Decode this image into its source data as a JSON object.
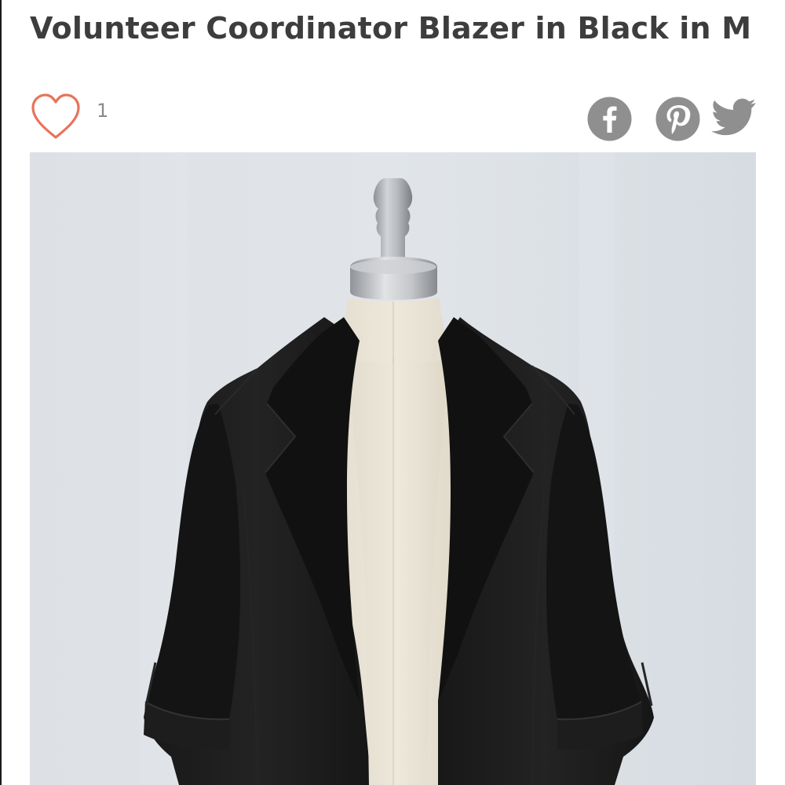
{
  "product": {
    "title": "Volunteer Coordinator Blazer in Black in M"
  },
  "likes": {
    "count": "1",
    "icon": "heart-outline-icon",
    "color": "#e8735a"
  },
  "share": {
    "icons": [
      "facebook-icon",
      "pinterest-icon",
      "twitter-icon"
    ],
    "color": "#8f8f8f"
  },
  "image": {
    "subject": "black blazer on dress form",
    "background_color": "#d9dee3"
  }
}
